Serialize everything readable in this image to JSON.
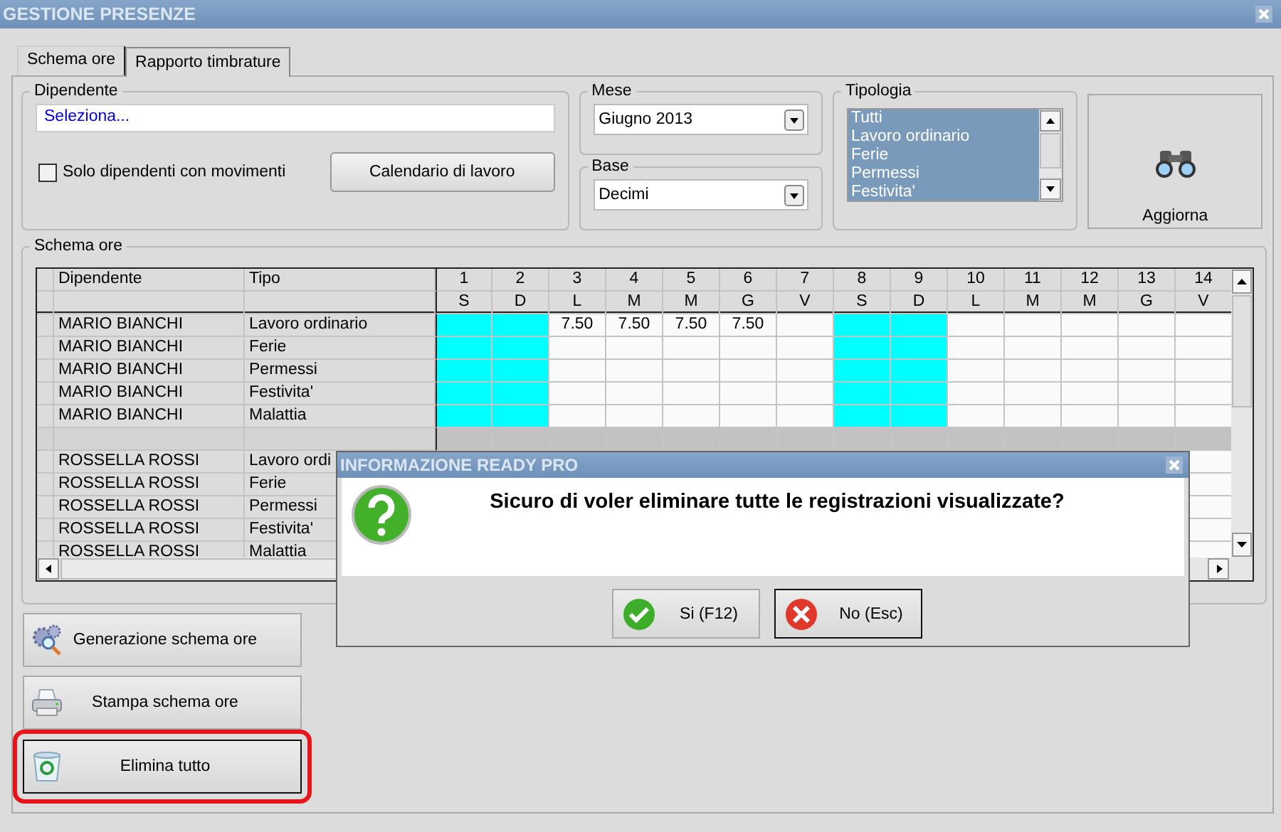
{
  "window": {
    "title": "GESTIONE PRESENZE"
  },
  "tabs": [
    {
      "label": "Schema ore",
      "selected": true
    },
    {
      "label": "Rapporto timbrature",
      "selected": false
    }
  ],
  "employee": {
    "legend": "Dipendente",
    "value": "Seleziona...",
    "only_with_movements": {
      "label": "Solo dipendenti con movimenti",
      "checked": false
    },
    "calendar_button": "Calendario di lavoro"
  },
  "month": {
    "legend": "Mese",
    "value": "Giugno 2013"
  },
  "base": {
    "legend": "Base",
    "value": "Decimi"
  },
  "type_filter": {
    "legend": "Tipologia",
    "items": [
      {
        "label": "Tutti",
        "selected": true
      },
      {
        "label": "Lavoro ordinario",
        "selected": true
      },
      {
        "label": "Ferie",
        "selected": true
      },
      {
        "label": "Permessi",
        "selected": true
      },
      {
        "label": "Festivita'",
        "selected": true
      }
    ]
  },
  "refresh_button": "Aggiorna",
  "schedule": {
    "legend": "Schema ore",
    "columns": [
      "Dipendente",
      "Tipo"
    ],
    "days": [
      {
        "number": "1",
        "weekday": "S",
        "weekend": true
      },
      {
        "number": "2",
        "weekday": "D",
        "weekend": true
      },
      {
        "number": "3",
        "weekday": "L",
        "weekend": false
      },
      {
        "number": "4",
        "weekday": "M",
        "weekend": false
      },
      {
        "number": "5",
        "weekday": "M",
        "weekend": false
      },
      {
        "number": "6",
        "weekday": "G",
        "weekend": false
      },
      {
        "number": "7",
        "weekday": "V",
        "weekend": false
      },
      {
        "number": "8",
        "weekday": "S",
        "weekend": true
      },
      {
        "number": "9",
        "weekday": "D",
        "weekend": true
      },
      {
        "number": "10",
        "weekday": "L",
        "weekend": false
      },
      {
        "number": "11",
        "weekday": "M",
        "weekend": false
      },
      {
        "number": "12",
        "weekday": "M",
        "weekend": false
      },
      {
        "number": "13",
        "weekday": "G",
        "weekend": false
      },
      {
        "number": "14",
        "weekday": "V",
        "weekend": false
      }
    ],
    "rows": [
      {
        "kind": "entry",
        "employee": "MARIO BIANCHI",
        "type": "Lavoro ordinario",
        "cells": [
          {},
          {},
          {
            "text": "7.50"
          },
          {
            "text": "7.50"
          },
          {
            "text": "7.50"
          },
          {
            "text": "7.50"
          }
        ]
      },
      {
        "kind": "entry",
        "employee": "MARIO BIANCHI",
        "type": "Ferie"
      },
      {
        "kind": "entry",
        "employee": "MARIO BIANCHI",
        "type": "Permessi"
      },
      {
        "kind": "entry",
        "employee": "MARIO BIANCHI",
        "type": "Festivita'"
      },
      {
        "kind": "entry",
        "employee": "MARIO BIANCHI",
        "type": "Malattia"
      },
      {
        "kind": "separator"
      },
      {
        "kind": "entry",
        "employee": "ROSSELLA ROSSI",
        "type": "Lavoro ordi"
      },
      {
        "kind": "entry",
        "employee": "ROSSELLA ROSSI",
        "type": "Ferie"
      },
      {
        "kind": "entry",
        "employee": "ROSSELLA ROSSI",
        "type": "Permessi"
      },
      {
        "kind": "entry",
        "employee": "ROSSELLA ROSSI",
        "type": "Festivita'"
      },
      {
        "kind": "entry",
        "employee": "ROSSELLA ROSSI",
        "type": "Malattia"
      }
    ]
  },
  "actions": [
    {
      "label": "Generazione schema ore",
      "kind": "generate",
      "highlighted": false
    },
    {
      "label": "Stampa schema ore",
      "kind": "print",
      "highlighted": false
    },
    {
      "label": "Elimina tutto",
      "kind": "delete",
      "highlighted": true
    }
  ],
  "dialog": {
    "title": "INFORMAZIONE READY PRO",
    "message": "Sicuro di voler eliminare tutte le registrazioni visualizzate?",
    "buttons": [
      {
        "label": "Si (F12)",
        "kind": "confirm",
        "focused": false
      },
      {
        "label": "No (Esc)",
        "kind": "cancel",
        "focused": true
      }
    ]
  }
}
